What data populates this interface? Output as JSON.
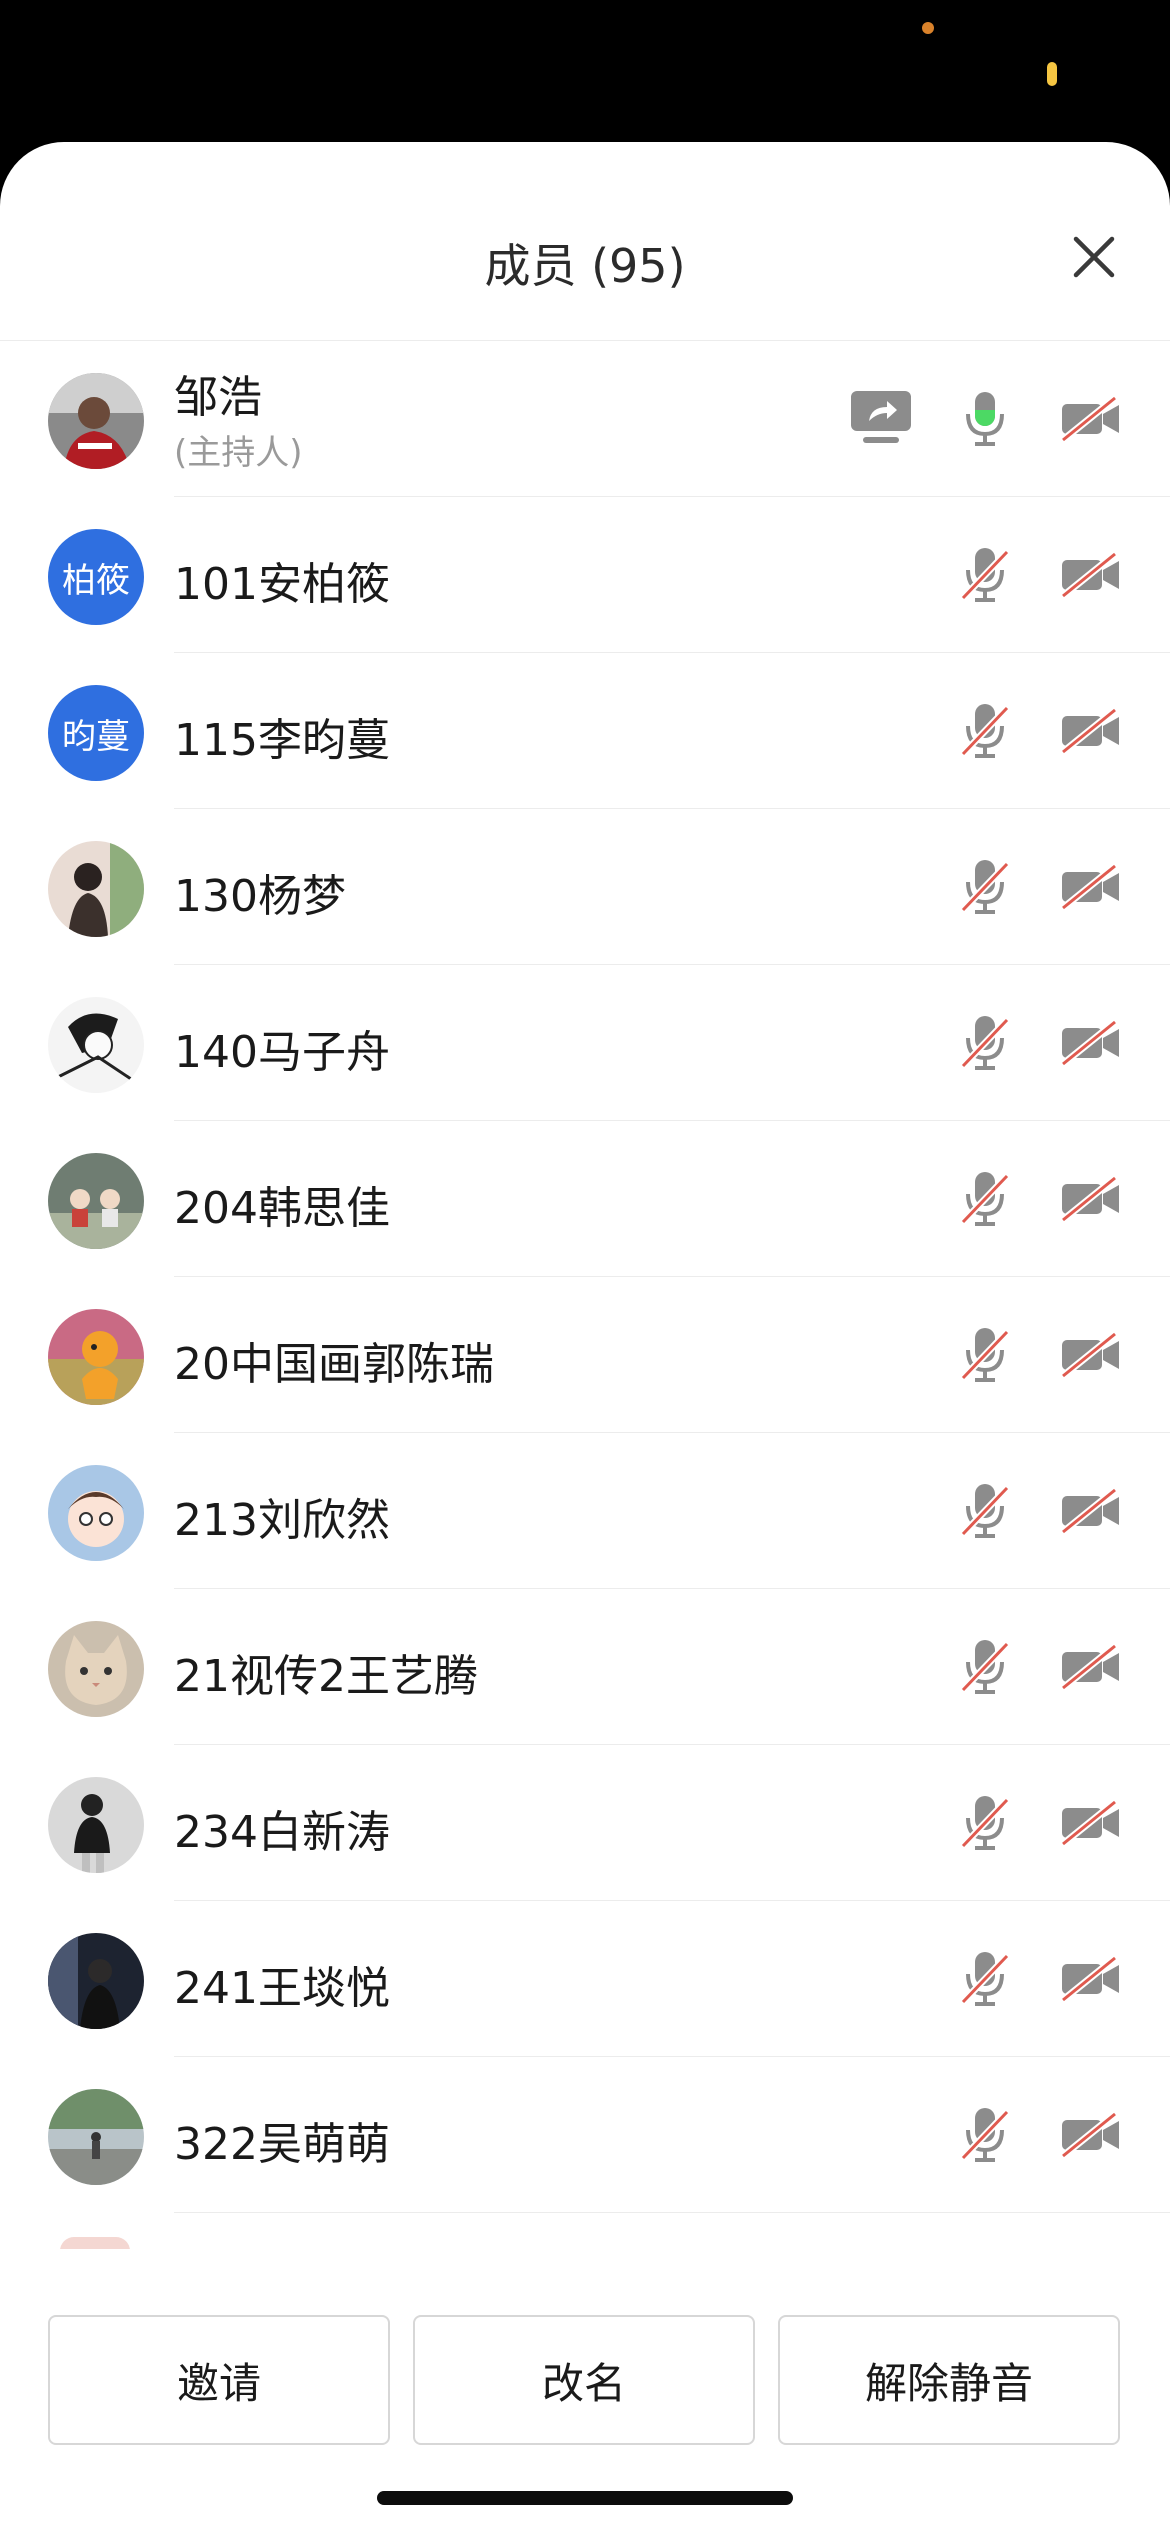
{
  "header": {
    "title": "成员 (95)"
  },
  "host": {
    "name": "邹浩",
    "role": "(主持人)"
  },
  "members": [
    {
      "name": "101安柏筱",
      "avatar_text": "柏筱"
    },
    {
      "name": "115李昀蔓",
      "avatar_text": "昀蔓"
    },
    {
      "name": "130杨梦"
    },
    {
      "name": "140马子舟"
    },
    {
      "name": "204韩思佳"
    },
    {
      "name": "20中国画郭陈瑞"
    },
    {
      "name": "213刘欣然"
    },
    {
      "name": "21视传2王艺腾"
    },
    {
      "name": "234白新涛"
    },
    {
      "name": "241王埮悦"
    },
    {
      "name": "322吴萌萌"
    }
  ],
  "actions": {
    "invite": "邀请",
    "rename": "改名",
    "unmute_all": "解除静音"
  },
  "icons": {
    "share": "screen-share-icon",
    "mic_active": "microphone-active-icon",
    "mic_muted": "microphone-muted-icon",
    "cam_off": "camera-off-icon",
    "close": "close-icon"
  },
  "colors": {
    "avatar_blue": "#2f6fe0",
    "mute_red": "#e05a4f",
    "mic_green": "#4cd964",
    "icon_gray": "#8c8c8c"
  }
}
